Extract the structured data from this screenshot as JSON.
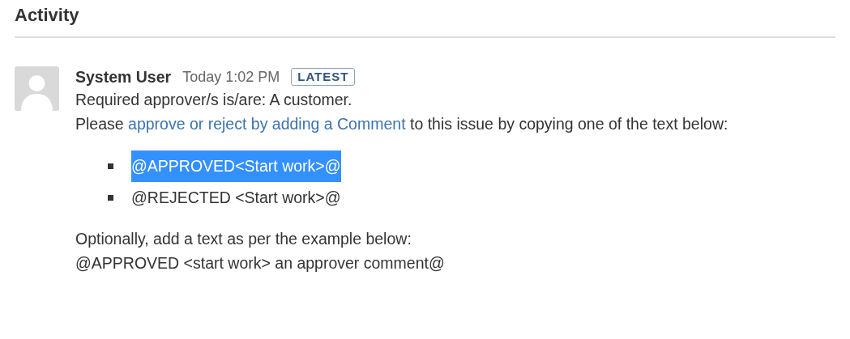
{
  "heading": "Activity",
  "comment": {
    "author": "System User",
    "time": "Today 1:02 PM",
    "badge": "LATEST",
    "required": "Required approver/s is/are: A customer.",
    "instruction": {
      "before": "Please ",
      "link": "approve or reject by adding a Comment",
      "after": " to this issue by copying one of the text below:"
    },
    "options": [
      {
        "text": "@APPROVED<Start work>@",
        "selected": true
      },
      {
        "text": "@REJECTED <Start work>@",
        "selected": false
      }
    ],
    "optional_note": "Optionally, add a text as per the example below:",
    "example": "@APPROVED <start work> an approver comment@"
  }
}
